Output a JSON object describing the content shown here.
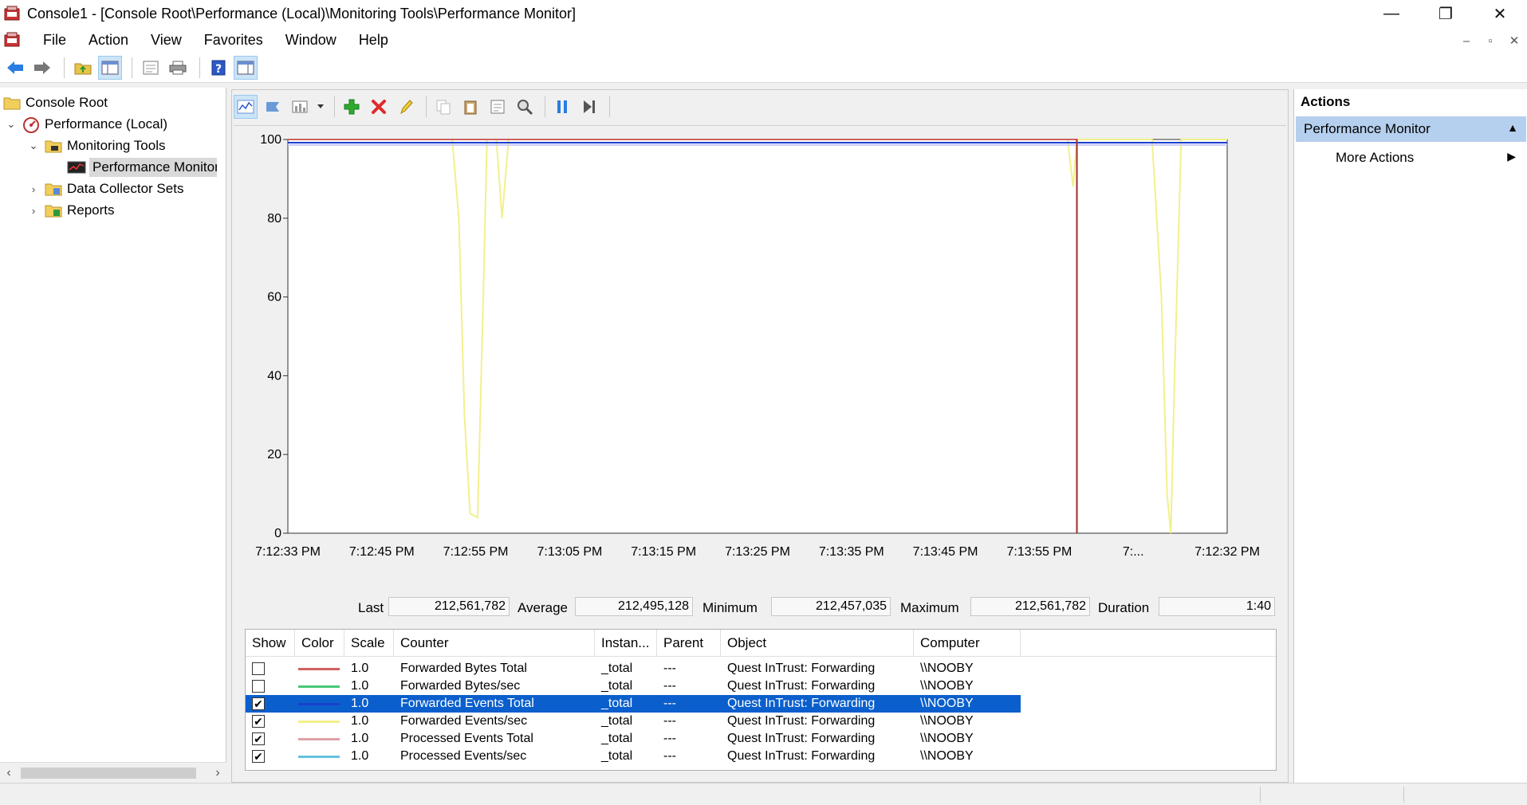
{
  "window": {
    "title": "Console1 - [Console Root\\Performance (Local)\\Monitoring Tools\\Performance Monitor]",
    "minimize": "—",
    "restore": "❐",
    "close": "✕"
  },
  "menu": {
    "items": [
      "File",
      "Action",
      "View",
      "Favorites",
      "Window",
      "Help"
    ],
    "mdi": [
      "–",
      "▫",
      "✕"
    ]
  },
  "tree": {
    "items": [
      {
        "label": "Console Root",
        "icon": "folder-icon"
      },
      {
        "label": "Performance (Local)",
        "icon": "performance-icon"
      },
      {
        "label": "Monitoring Tools",
        "icon": "folder-icon"
      },
      {
        "label": "Performance Monitor",
        "icon": "monitor-icon"
      },
      {
        "label": "Data Collector Sets",
        "icon": "data-collector-icon"
      },
      {
        "label": "Reports",
        "icon": "reports-icon"
      }
    ]
  },
  "chart_data": {
    "type": "line",
    "ylim": [
      0,
      100
    ],
    "yticks": [
      0,
      20,
      40,
      60,
      80,
      100
    ],
    "xticks": [
      "7:12:33 PM",
      "7:12:45 PM",
      "7:12:55 PM",
      "7:13:05 PM",
      "7:13:15 PM",
      "7:13:25 PM",
      "7:13:35 PM",
      "7:13:45 PM",
      "7:13:55 PM",
      "7:...",
      "7:12:32 PM"
    ],
    "grid": false,
    "samples": 100,
    "current_index": 84,
    "series": [
      {
        "color": "#f2f08a",
        "points": [
          [
            0,
            100
          ],
          [
            17.5,
            100
          ],
          [
            18.2,
            80
          ],
          [
            18.8,
            30
          ],
          [
            19.4,
            5
          ],
          [
            20.2,
            4
          ],
          [
            20.8,
            60
          ],
          [
            21.2,
            100
          ],
          [
            22.2,
            100
          ],
          [
            22.8,
            80
          ],
          [
            23.5,
            100
          ],
          [
            83,
            100
          ],
          [
            83.6,
            88
          ],
          [
            84,
            100
          ],
          [
            92,
            100
          ],
          [
            93,
            60
          ],
          [
            93.6,
            10
          ],
          [
            94,
            0
          ],
          [
            94.4,
            40
          ],
          [
            95.1,
            100
          ],
          [
            100,
            100
          ]
        ]
      },
      {
        "color": "#1a3fd0",
        "points": [
          [
            0,
            99.2
          ],
          [
            100,
            99.2
          ]
        ]
      },
      {
        "color": "#c8c8ff",
        "points": [
          [
            0,
            98.6
          ],
          [
            100,
            98.6
          ]
        ]
      },
      {
        "color": "#d06060",
        "points": [
          [
            0,
            100
          ],
          [
            84,
            100
          ],
          [
            84,
            0
          ]
        ]
      }
    ]
  },
  "stats": {
    "last_label": "Last",
    "last": "212,561,782",
    "average_label": "Average",
    "average": "212,495,128",
    "minimum_label": "Minimum",
    "minimum": "212,457,035",
    "maximum_label": "Maximum",
    "maximum": "212,561,782",
    "duration_label": "Duration",
    "duration": "1:40"
  },
  "legend": {
    "headers": [
      "Show",
      "Color",
      "Scale",
      "Counter",
      "Instan...",
      "Parent",
      "Object",
      "Computer"
    ],
    "rows": [
      {
        "show": false,
        "color": "#d06060",
        "scale": "1.0",
        "counter": "Forwarded Bytes Total",
        "instance": "_total",
        "parent": "---",
        "object": "Quest InTrust: Forwarding",
        "computer": "\\\\NOOBY"
      },
      {
        "show": false,
        "color": "#48c87a",
        "scale": "1.0",
        "counter": "Forwarded Bytes/sec",
        "instance": "_total",
        "parent": "---",
        "object": "Quest InTrust: Forwarding",
        "computer": "\\\\NOOBY"
      },
      {
        "show": true,
        "color": "#1a3fd0",
        "scale": "1.0",
        "counter": "Forwarded Events Total",
        "instance": "_total",
        "parent": "---",
        "object": "Quest InTrust: Forwarding",
        "computer": "\\\\NOOBY"
      },
      {
        "show": true,
        "color": "#f2f08a",
        "scale": "1.0",
        "counter": "Forwarded Events/sec",
        "instance": "_total",
        "parent": "---",
        "object": "Quest InTrust: Forwarding",
        "computer": "\\\\NOOBY"
      },
      {
        "show": true,
        "color": "#e0a0a8",
        "scale": "1.0",
        "counter": "Processed Events Total",
        "instance": "_total",
        "parent": "---",
        "object": "Quest InTrust: Forwarding",
        "computer": "\\\\NOOBY"
      },
      {
        "show": true,
        "color": "#66c0e0",
        "scale": "1.0",
        "counter": "Processed Events/sec",
        "instance": "_total",
        "parent": "---",
        "object": "Quest InTrust: Forwarding",
        "computer": "\\\\NOOBY"
      }
    ],
    "selected_row": 2
  },
  "actions": {
    "title": "Actions",
    "section": "Performance Monitor",
    "item": "More Actions"
  }
}
